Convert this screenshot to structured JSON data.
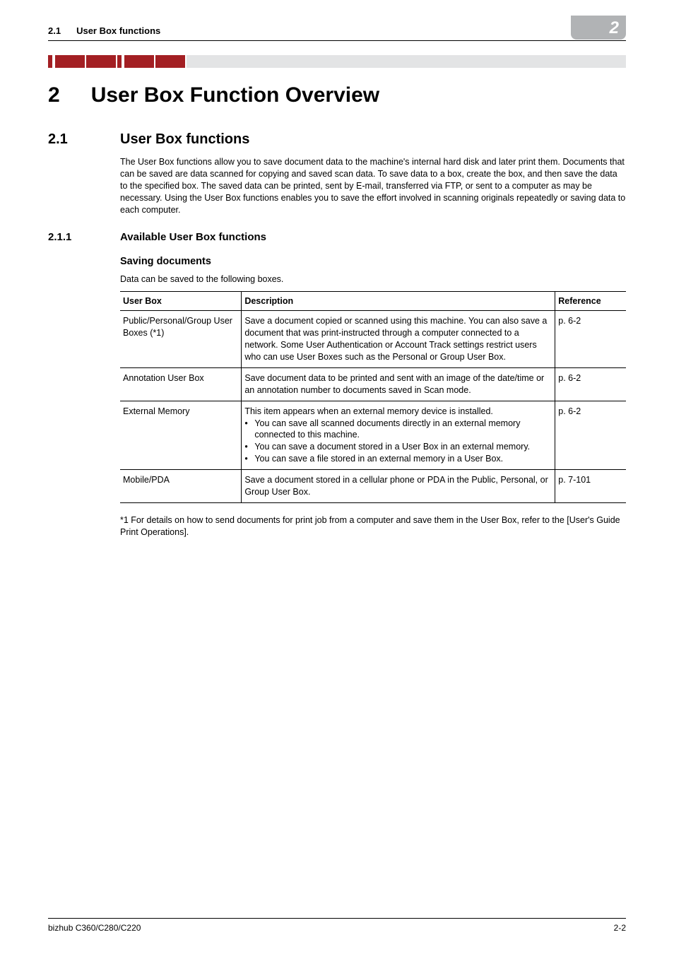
{
  "header": {
    "section_number": "2.1",
    "section_title": "User Box functions",
    "chapter_badge": "2"
  },
  "chapter": {
    "number": "2",
    "title": "User Box Function Overview"
  },
  "section": {
    "number": "2.1",
    "title": "User Box functions",
    "paragraph": "The User Box functions allow you to save document data to the machine's internal hard disk and later print them. Documents that can be saved are data scanned for copying and saved scan data. To save data to a box, create the box, and then save the data to the specified box. The saved data can be printed, sent by E-mail, transferred via FTP, or sent to a computer as may be necessary. Using the User Box functions enables you to save the effort involved in scanning originals repeatedly or saving data to each computer."
  },
  "subsection": {
    "number": "2.1.1",
    "title": "Available User Box functions"
  },
  "saving": {
    "heading": "Saving documents",
    "intro": "Data can be saved to the following boxes."
  },
  "table": {
    "headers": {
      "c1": "User Box",
      "c2": "Description",
      "c3": "Reference"
    },
    "rows": [
      {
        "c1": "Public/Personal/Group User Boxes (*1)",
        "c2": "Save a document copied or scanned using this machine. You can also save a document that was print-instructed through a computer connected to a network. Some User Authentication or Account Track settings restrict users who can use User Boxes such as the Personal or Group User Box.",
        "c3": "p. 6-2"
      },
      {
        "c1": "Annotation User Box",
        "c2": "Save document data to be printed and sent with an image of the date/time or an annotation number to documents saved in Scan mode.",
        "c3": "p. 6-2"
      },
      {
        "c1": "External Memory",
        "c2_intro": "This item appears when an external memory device is installed.",
        "c2_bullets": [
          "You can save all scanned documents directly in an external memory connected to this machine.",
          "You can save a document stored in a User Box in an external memory.",
          "You can save a file stored in an external memory in a User Box."
        ],
        "c3": "p. 6-2"
      },
      {
        "c1": "Mobile/PDA",
        "c2": "Save a document stored in a cellular phone or PDA in the Public, Personal, or Group User Box.",
        "c3": "p. 7-101"
      }
    ]
  },
  "footnote": "*1 For details on how to send documents for print job from a computer and save them in the User Box, refer to the [User's Guide Print Operations].",
  "footer": {
    "left": "bizhub C360/C280/C220",
    "right": "2-2"
  }
}
